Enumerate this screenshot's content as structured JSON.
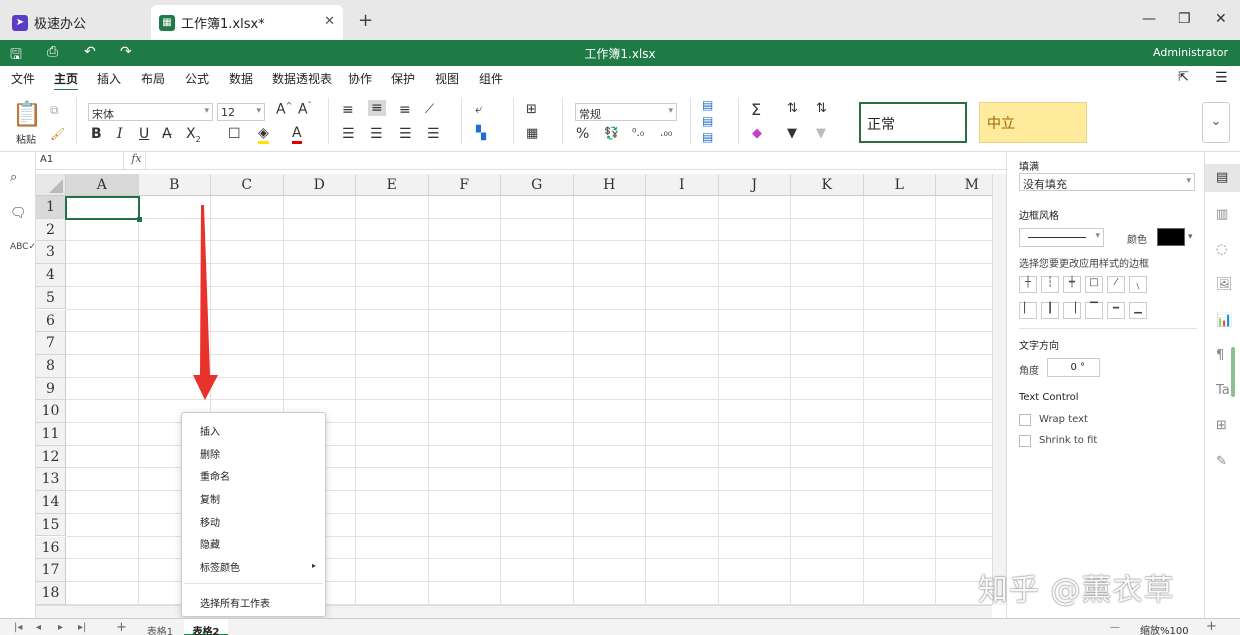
{
  "tabs": [
    {
      "label": "极速办公",
      "icon": "app-icon"
    },
    {
      "label": "工作簿1.xlsx*",
      "icon": "spreadsheet-icon"
    }
  ],
  "window": {
    "minimize": "—",
    "restore": "❐",
    "close": "✕"
  },
  "titlebar": {
    "document": "工作簿1.xlsx",
    "user": "Administrator"
  },
  "menu": [
    "文件",
    "主页",
    "插入",
    "布局",
    "公式",
    "数据",
    "数据透视表",
    "协作",
    "保护",
    "视图",
    "组件"
  ],
  "ribbon": {
    "paste_label": "粘贴",
    "font_name": "宋体",
    "font_size": "12",
    "number_format": "常规",
    "style_normal": "正常",
    "style_neutral": "中立"
  },
  "formula": {
    "cell_ref": "A1",
    "fx": "fx",
    "value": ""
  },
  "columns": [
    "A",
    "B",
    "C",
    "D",
    "E",
    "F",
    "G",
    "H",
    "I",
    "J",
    "K",
    "L",
    "M"
  ],
  "rows": [
    "1",
    "2",
    "3",
    "4",
    "5",
    "6",
    "7",
    "8",
    "9",
    "10",
    "11",
    "12",
    "13",
    "14",
    "15",
    "16",
    "17",
    "18"
  ],
  "context_menu": {
    "items": [
      "插入",
      "删除",
      "重命名",
      "复制",
      "移动",
      "隐藏",
      "标签颜色"
    ],
    "last": "选择所有工作表"
  },
  "sheets": [
    "表格1",
    "表格2"
  ],
  "status": {
    "zoom": "缩放%100",
    "minus": "—",
    "plus": "+"
  },
  "right_panel": {
    "fill_label": "填满",
    "fill_value": "没有填充",
    "border_label": "边框风格",
    "color_label": "颜色",
    "border_hint": "选择您要更改应用样式的边框",
    "text_dir_label": "文字方向",
    "angle_label": "角度",
    "angle_value": "0 °",
    "text_control_label": "Text Control",
    "wrap_text": "Wrap text",
    "shrink_to_fit": "Shrink to fit",
    "border_color": "#000000"
  },
  "watermark": "知乎 @薰衣草",
  "accent": "#1e7b45"
}
